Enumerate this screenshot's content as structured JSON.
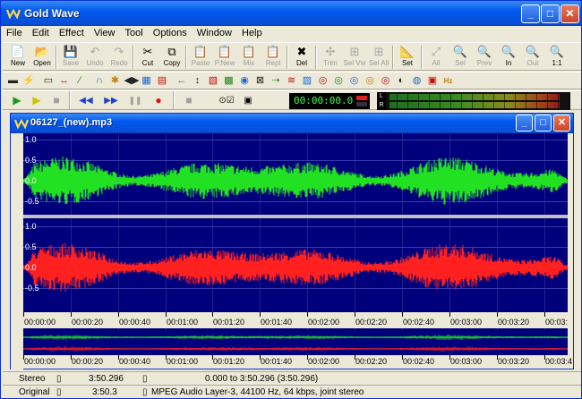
{
  "app": {
    "title": "Gold Wave",
    "icon": "goldwave-logo-icon",
    "caption": {
      "minimize": "_",
      "maximize": "□",
      "close": "✕"
    }
  },
  "menu": [
    "File",
    "Edit",
    "Effect",
    "View",
    "Tool",
    "Options",
    "Window",
    "Help"
  ],
  "toolbar": [
    {
      "label": "New",
      "icon": "📄",
      "enabled": true
    },
    {
      "label": "Open",
      "icon": "📂",
      "enabled": true
    },
    {
      "label": "Save",
      "icon": "💾",
      "enabled": false
    },
    {
      "label": "Undo",
      "icon": "↶",
      "enabled": false
    },
    {
      "label": "Redo",
      "icon": "↷",
      "enabled": false
    },
    {
      "label": "Cut",
      "icon": "✂",
      "enabled": true
    },
    {
      "label": "Copy",
      "icon": "⧉",
      "enabled": true
    },
    {
      "label": "Paste",
      "icon": "📋",
      "enabled": false
    },
    {
      "label": "P.New",
      "icon": "📋",
      "enabled": false
    },
    {
      "label": "Mix",
      "icon": "📋",
      "enabled": false
    },
    {
      "label": "Repl",
      "icon": "📋",
      "enabled": false
    },
    {
      "label": "Del",
      "icon": "✖",
      "enabled": true
    },
    {
      "label": "Trim",
      "icon": "✣",
      "enabled": false
    },
    {
      "label": "Sel Vw",
      "icon": "⊞",
      "enabled": false
    },
    {
      "label": "Sel All",
      "icon": "⊞",
      "enabled": false
    },
    {
      "label": "Set",
      "icon": "📐",
      "enabled": true
    },
    {
      "label": "All",
      "icon": "⤢",
      "enabled": false
    },
    {
      "label": "Sel",
      "icon": "🔍",
      "enabled": false
    },
    {
      "label": "Prev",
      "icon": "🔍",
      "enabled": false
    },
    {
      "label": "In",
      "icon": "🔍",
      "enabled": true
    },
    {
      "label": "Out",
      "icon": "🔍",
      "enabled": false
    },
    {
      "label": "1:1",
      "icon": "🔍",
      "enabled": true
    }
  ],
  "effects_toolbar": [
    "▬",
    "⚡",
    "▭",
    "↔",
    "∕",
    "∩",
    "✱",
    "◀▶",
    "▦",
    "▤",
    "←",
    "↕",
    "▧",
    "▩",
    "◉",
    "⊠",
    "⇢",
    "≋",
    "▨",
    "◎",
    "◎",
    "◎",
    "◎",
    "◎",
    "◐",
    "◍",
    "▣",
    "Hz"
  ],
  "transport": {
    "play_icon": "▶",
    "play_sel_icon": "▶",
    "stop_icon": "■",
    "rewind_icon": "◀◀",
    "forward_icon": "▶▶",
    "pause_icon": "❚❚",
    "record_icon": "●",
    "loop_icon": "■",
    "time": "00:00:00.0",
    "meter_labels": {
      "left": "L",
      "right": "R"
    },
    "meter_left_level": 0.96,
    "meter_right_level": 0.96
  },
  "document": {
    "title": "06127_(new).mp3",
    "channel_top_ticks": [
      "1.0",
      "0.5",
      "0.0",
      "-0.5"
    ],
    "channel_bottom_ticks": [
      "1.0",
      "0.5",
      "0.0",
      "-0.5"
    ],
    "colors": {
      "left_channel": "#22e022",
      "right_channel": "#ff2020",
      "background": "#00007d"
    },
    "timeline": [
      "00:00:00",
      "00:00:20",
      "00:00:40",
      "00:01:00",
      "00:01:20",
      "00:01:40",
      "00:02:00",
      "00:02:20",
      "00:02:40",
      "00:03:00",
      "00:03:20",
      "00:03:"
    ],
    "overview_timeline": [
      "00:00:00",
      "00:00:20",
      "00:00:40",
      "00:01:00",
      "00:01:20",
      "00:01:40",
      "00:02:00",
      "00:02:20",
      "00:02:40",
      "00:03:00",
      "00:03:20",
      "00:03:4"
    ]
  },
  "status": {
    "row1": {
      "channels": "Stereo",
      "length": "3:50.296",
      "selection": "0.000 to 3:50.296 (3:50.296)"
    },
    "row2": {
      "mode": "Original",
      "length": "3:50.3",
      "format": "MPEG Audio Layer-3, 44100 Hz, 64 kbps, joint stereo"
    }
  }
}
